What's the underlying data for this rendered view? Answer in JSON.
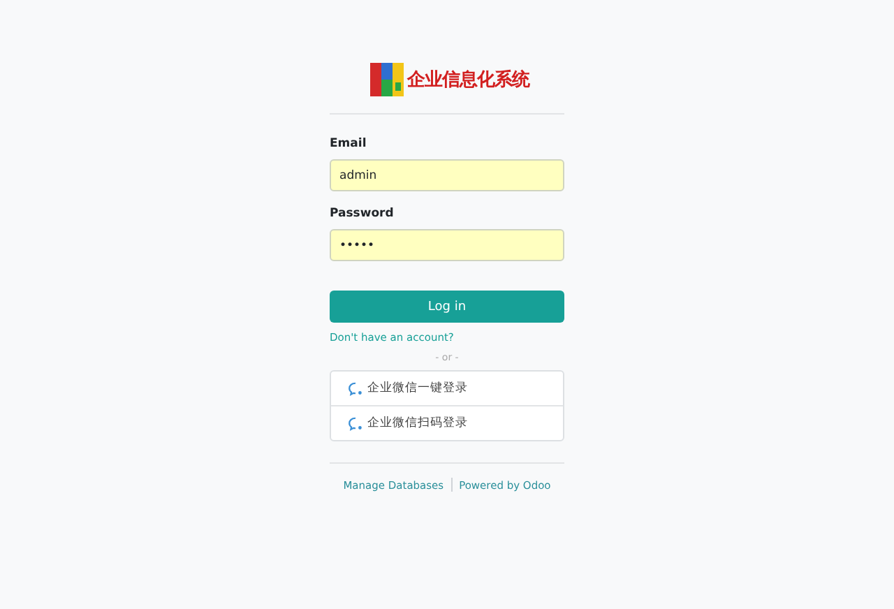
{
  "brand": {
    "name": "企业信息化系统"
  },
  "fields": [
    {
      "label": "Email",
      "value": "admin"
    },
    {
      "label": "Password",
      "value": "•••••"
    }
  ],
  "login_button": "Log in",
  "signup_link": "Don't have an account?",
  "separator": "- or -",
  "oauth_providers": [
    {
      "label": "企业微信一键登录"
    },
    {
      "label": "企业微信扫码登录"
    }
  ],
  "footer_links": [
    "Manage Databases",
    "Powered by Odoo"
  ]
}
